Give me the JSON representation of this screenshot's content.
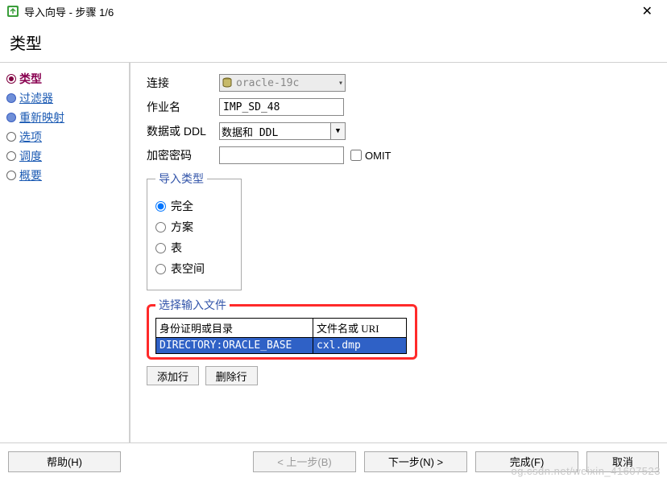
{
  "window": {
    "title": "导入向导 - 步骤 1/6"
  },
  "heading": "类型",
  "sidebar": {
    "items": [
      {
        "label": "类型"
      },
      {
        "label": "过滤器"
      },
      {
        "label": "重新映射"
      },
      {
        "label": "选项"
      },
      {
        "label": "调度"
      },
      {
        "label": "概要"
      }
    ]
  },
  "form": {
    "connection": {
      "label": "连接",
      "value": "oracle-19c"
    },
    "jobname": {
      "label": "作业名",
      "value": "IMP_SD_48"
    },
    "data_ddl": {
      "label": "数据或 DDL",
      "value": "数据和 DDL"
    },
    "password": {
      "label": "加密密码",
      "value": ""
    },
    "omit": {
      "label": "OMIT"
    }
  },
  "import_type": {
    "legend": "导入类型",
    "options": [
      {
        "label": "完全",
        "checked": true
      },
      {
        "label": "方案",
        "checked": false
      },
      {
        "label": "表",
        "checked": false
      },
      {
        "label": "表空间",
        "checked": false
      }
    ]
  },
  "files": {
    "legend": "选择输入文件",
    "headers": {
      "col1": "身份证明或目录",
      "col2": "文件名或 URI"
    },
    "rows": [
      {
        "dir": "DIRECTORY:ORACLE_BASE",
        "file": "cxl.dmp"
      }
    ],
    "add_label": "添加行",
    "del_label": "删除行"
  },
  "footer": {
    "help": "帮助(H)",
    "back": "< 上一步(B)",
    "next": "下一步(N) >",
    "finish": "完成(F)",
    "cancel": "取消"
  },
  "watermark": "og.csdn.net/weixin_41607523"
}
